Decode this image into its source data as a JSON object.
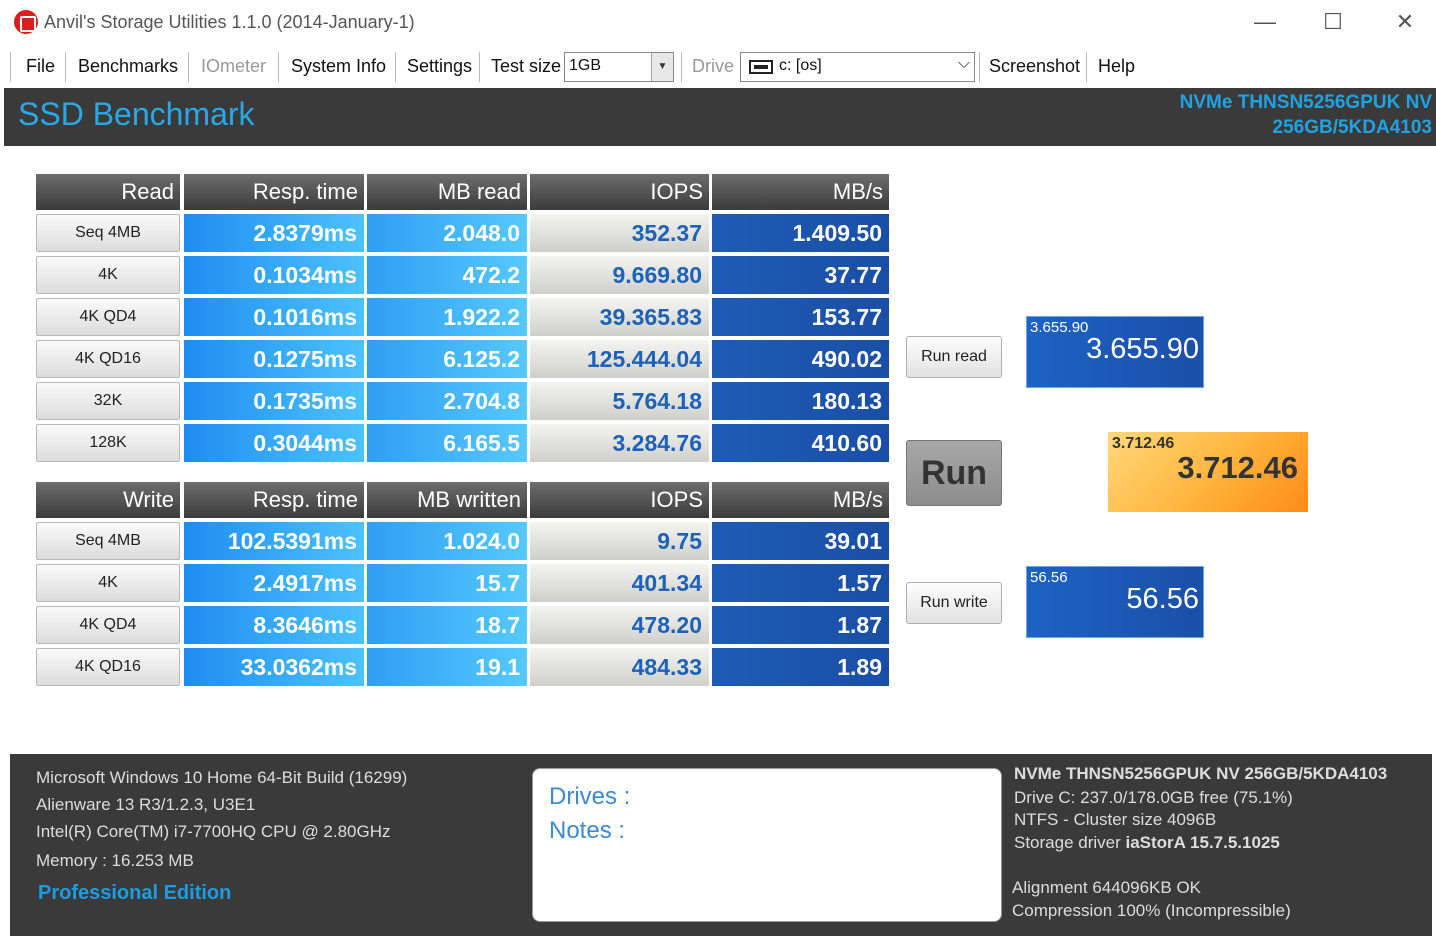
{
  "window": {
    "title": "Anvil's Storage Utilities 1.1.0 (2014-January-1)",
    "controls": {
      "minimize": "—",
      "maximize": "☐",
      "close": "✕"
    }
  },
  "menu": {
    "file": "File",
    "benchmarks": "Benchmarks",
    "iometer": "IOmeter",
    "system_info": "System Info",
    "settings": "Settings",
    "test_size_label": "Test size",
    "test_size_value": "1GB",
    "drive_label": "Drive",
    "drive_value": "c: [os]",
    "screenshot": "Screenshot",
    "help": "Help"
  },
  "header": {
    "title": "SSD Benchmark",
    "drive_line1": "NVMe THNSN5256GPUK NV",
    "drive_line2": "256GB/5KDA4103"
  },
  "read_table": {
    "headers": [
      "Read",
      "Resp. time",
      "MB read",
      "IOPS",
      "MB/s"
    ],
    "rows": [
      {
        "label": "Seq 4MB",
        "resp": "2.8379ms",
        "mb": "2.048.0",
        "iops": "352.37",
        "mbs": "1.409.50"
      },
      {
        "label": "4K",
        "resp": "0.1034ms",
        "mb": "472.2",
        "iops": "9.669.80",
        "mbs": "37.77"
      },
      {
        "label": "4K QD4",
        "resp": "0.1016ms",
        "mb": "1.922.2",
        "iops": "39.365.83",
        "mbs": "153.77"
      },
      {
        "label": "4K QD16",
        "resp": "0.1275ms",
        "mb": "6.125.2",
        "iops": "125.444.04",
        "mbs": "490.02"
      },
      {
        "label": "32K",
        "resp": "0.1735ms",
        "mb": "2.704.8",
        "iops": "5.764.18",
        "mbs": "180.13"
      },
      {
        "label": "128K",
        "resp": "0.3044ms",
        "mb": "6.165.5",
        "iops": "3.284.76",
        "mbs": "410.60"
      }
    ]
  },
  "write_table": {
    "headers": [
      "Write",
      "Resp. time",
      "MB written",
      "IOPS",
      "MB/s"
    ],
    "rows": [
      {
        "label": "Seq 4MB",
        "resp": "102.5391ms",
        "mb": "1.024.0",
        "iops": "9.75",
        "mbs": "39.01"
      },
      {
        "label": "4K",
        "resp": "2.4917ms",
        "mb": "15.7",
        "iops": "401.34",
        "mbs": "1.57"
      },
      {
        "label": "4K QD4",
        "resp": "8.3646ms",
        "mb": "18.7",
        "iops": "478.20",
        "mbs": "1.87"
      },
      {
        "label": "4K QD16",
        "resp": "33.0362ms",
        "mb": "19.1",
        "iops": "484.33",
        "mbs": "1.89"
      }
    ]
  },
  "controls": {
    "run_read": "Run read",
    "run": "Run",
    "run_write": "Run write"
  },
  "scores": {
    "read_small": "3.655.90",
    "read_big": "3.655.90",
    "total_small": "3.712.46",
    "total_big": "3.712.46",
    "write_small": "56.56",
    "write_big": "56.56"
  },
  "footer": {
    "os": "Microsoft Windows 10 Home 64-Bit Build (16299)",
    "system": "Alienware 13 R3/1.2.3, U3E1",
    "cpu": "Intel(R) Core(TM) i7-7700HQ CPU @ 2.80GHz",
    "memory": "Memory : 16.253 MB",
    "edition": "Professional Edition",
    "drives_label": "Drives :",
    "notes_label": "Notes :",
    "drive_model": "NVMe THNSN5256GPUK NV 256GB/5KDA4103",
    "drive_free": "Drive C: 237.0/178.0GB free (75.1%)",
    "fs": "NTFS - Cluster size 4096B",
    "driver_prefix": "Storage driver ",
    "driver_value": "iaStorA 15.7.5.1025",
    "alignment": "Alignment 644096KB OK",
    "compression": "Compression 100% (Incompressible)"
  }
}
